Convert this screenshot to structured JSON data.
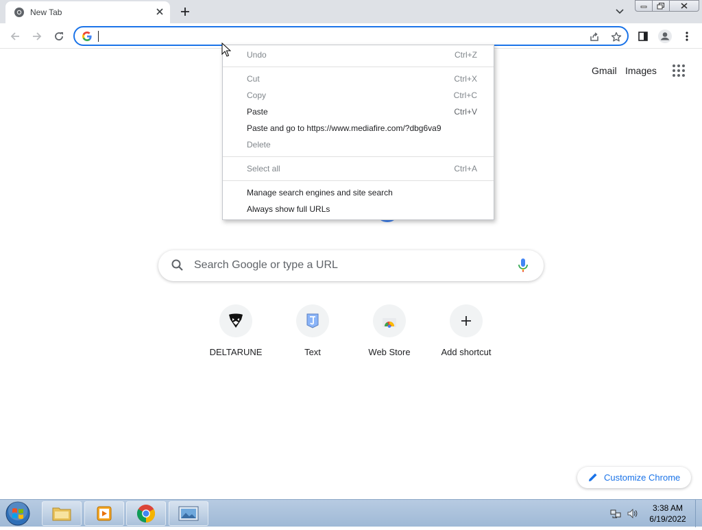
{
  "tab": {
    "title": "New Tab"
  },
  "ntp": {
    "top_links": [
      "Gmail",
      "Images"
    ],
    "search_placeholder": "Search Google or type a URL",
    "shortcuts": [
      "DELTARUNE",
      "Text",
      "Web Store",
      "Add shortcut"
    ],
    "customize_label": "Customize Chrome"
  },
  "context_menu": {
    "undo": {
      "label": "Undo",
      "shortcut": "Ctrl+Z"
    },
    "cut": {
      "label": "Cut",
      "shortcut": "Ctrl+X"
    },
    "copy": {
      "label": "Copy",
      "shortcut": "Ctrl+C"
    },
    "paste": {
      "label": "Paste",
      "shortcut": "Ctrl+V"
    },
    "paste_go": {
      "label": "Paste and go to https://www.mediafire.com/?dbg6va9"
    },
    "delete": {
      "label": "Delete"
    },
    "select_all": {
      "label": "Select all",
      "shortcut": "Ctrl+A"
    },
    "manage_search": {
      "label": "Manage search engines and site search"
    },
    "full_urls": {
      "label": "Always show full URLs"
    }
  },
  "taskbar": {
    "time": "3:38 AM",
    "date": "6/19/2022"
  },
  "colors": {
    "accent": "#1a73e8",
    "tabstrip": "#dee1e6",
    "taskbar": "#b7cbe2"
  }
}
